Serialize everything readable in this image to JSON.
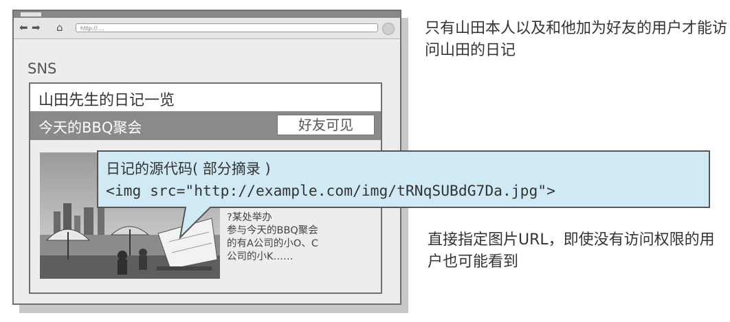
{
  "browser": {
    "url": "http://....",
    "site_name": "SNS"
  },
  "diary_page": {
    "title": "山田先生的日记一览",
    "entry": {
      "title": "今天的BBQ聚会",
      "visibility": "好友可见",
      "text": "?某处举办\n参与今天的BBQ聚会\n的有A公司的小O、C\n公司的小K……"
    }
  },
  "callout": {
    "label": "日记的源代码( 部分摘录 )",
    "code": "<img src=\"http://example.com/img/tRNqSUBdG7Da.jpg\">",
    "fill_color": "#cfe9f5",
    "border_color": "#555555"
  },
  "notes": {
    "top": "只有山田本人以及和他加为好友的用户才能访问山田的日记",
    "bottom": "直接指定图片URL，即使没有访问权限的用户也可能看到"
  },
  "icons": [
    "back-arrow-icon",
    "forward-arrow-icon",
    "home-icon",
    "reload-icon"
  ]
}
